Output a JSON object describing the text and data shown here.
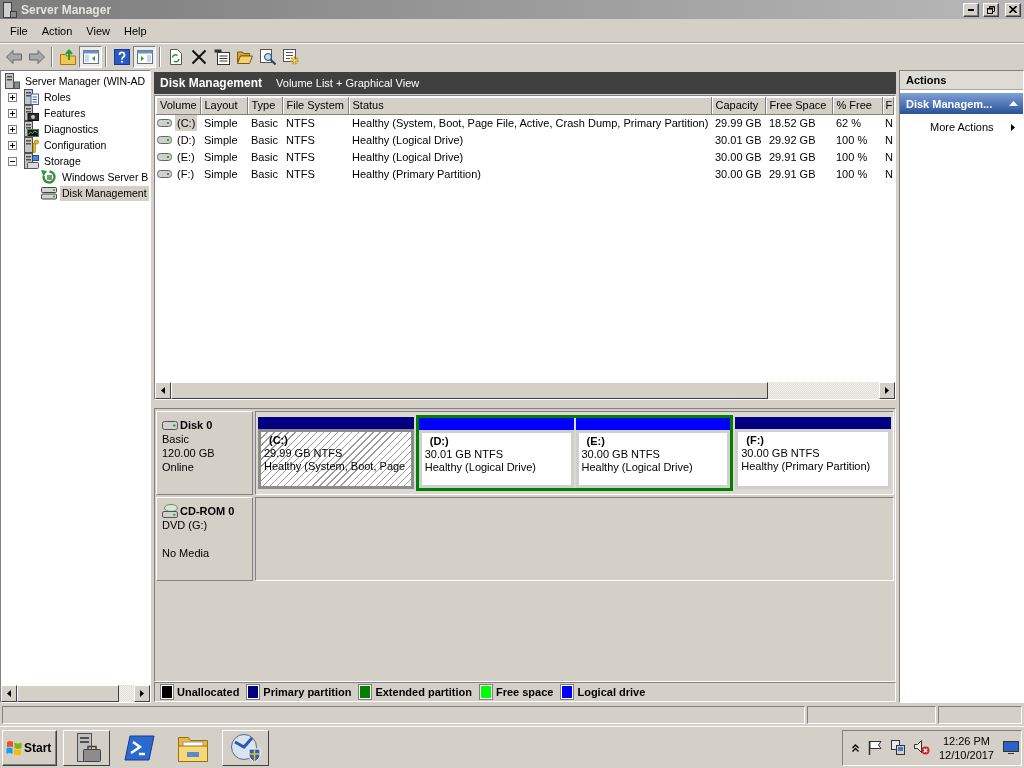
{
  "window": {
    "title": "Server Manager"
  },
  "menu": [
    "File",
    "Action",
    "View",
    "Help"
  ],
  "toolbar": [
    [
      {
        "kind": "back",
        "on": false
      },
      {
        "kind": "forward",
        "on": false
      }
    ],
    [
      {
        "kind": "up",
        "on": false
      },
      {
        "kind": "tree-toggle",
        "on": true
      }
    ],
    [
      {
        "kind": "help",
        "on": false
      },
      {
        "kind": "pane-toggle",
        "on": true
      }
    ],
    [
      {
        "kind": "refresh",
        "on": false
      },
      {
        "kind": "delete",
        "on": false
      },
      {
        "kind": "properties",
        "on": false
      },
      {
        "kind": "open",
        "on": false
      },
      {
        "kind": "find",
        "on": false
      },
      {
        "kind": "settings",
        "on": false
      }
    ]
  ],
  "tree": {
    "kind": "server",
    "label": "Server Manager (WIN-AD",
    "selected": false,
    "children": [
      {
        "kind": "roles",
        "label": "Roles",
        "expanded": false,
        "selected": false
      },
      {
        "kind": "features",
        "label": "Features",
        "expanded": false,
        "selected": false
      },
      {
        "kind": "diagnostics",
        "label": "Diagnostics",
        "expanded": false,
        "selected": false
      },
      {
        "kind": "configuration",
        "label": "Configuration",
        "expanded": false,
        "selected": false
      },
      {
        "kind": "storage",
        "label": "Storage",
        "expanded": true,
        "selected": false,
        "children": [
          {
            "kind": "backup",
            "label": "Windows Server B",
            "selected": false
          },
          {
            "kind": "disk-management",
            "label": "Disk Management",
            "selected": true
          }
        ]
      }
    ]
  },
  "panel": {
    "title": "Disk Management",
    "subtitle": "Volume List + Graphical View"
  },
  "table": {
    "columns": [
      "Volume",
      "Layout",
      "Type",
      "File System",
      "Status",
      "Capacity",
      "Free Space",
      "% Free",
      "F"
    ],
    "rows": [
      {
        "selected": true,
        "cells": [
          "(C:)",
          "Simple",
          "Basic",
          "NTFS",
          "Healthy (System, Boot, Page File, Active, Crash Dump, Primary Partition)",
          "29.99 GB",
          "18.52 GB",
          "62 %",
          "N"
        ]
      },
      {
        "selected": false,
        "cells": [
          "(D:)",
          "Simple",
          "Basic",
          "NTFS",
          "Healthy (Logical Drive)",
          "30.01 GB",
          "29.92 GB",
          "100 %",
          "N"
        ]
      },
      {
        "selected": false,
        "cells": [
          "(E:)",
          "Simple",
          "Basic",
          "NTFS",
          "Healthy (Logical Drive)",
          "30.00 GB",
          "29.91 GB",
          "100 %",
          "N"
        ]
      },
      {
        "selected": false,
        "cells": [
          "(F:)",
          "Simple",
          "Basic",
          "NTFS",
          "Healthy (Primary Partition)",
          "30.00 GB",
          "29.91 GB",
          "100 %",
          "N"
        ]
      }
    ]
  },
  "disks": [
    {
      "kind": "disk",
      "name": "Disk 0",
      "type": "Basic",
      "size": "120.00 GB",
      "status": "Online",
      "partitions": [
        {
          "kind": "primary",
          "color": "#000080",
          "label": "(C:)",
          "size": "29.99 GB NTFS",
          "status": "Healthy (System, Boot, Page",
          "selected": true
        },
        {
          "kind": "extended",
          "color": "#008000",
          "children": [
            {
              "kind": "logical",
              "color": "#0000ff",
              "label": "(D:)",
              "size": "30.01 GB NTFS",
              "status": "Healthy (Logical Drive)",
              "selected": false
            },
            {
              "kind": "logical",
              "color": "#0000ff",
              "label": "(E:)",
              "size": "30.00 GB NTFS",
              "status": "Healthy (Logical Drive)",
              "selected": false
            }
          ]
        },
        {
          "kind": "primary",
          "color": "#000080",
          "label": "(F:)",
          "size": "30.00 GB NTFS",
          "status": "Healthy (Primary Partition)",
          "selected": false
        }
      ]
    },
    {
      "kind": "cdrom",
      "name": "CD-ROM 0",
      "type": "DVD (G:)",
      "status": "No Media"
    }
  ],
  "legend": [
    {
      "label": "Unallocated",
      "color": "#000000"
    },
    {
      "label": "Primary partition",
      "color": "#000080"
    },
    {
      "label": "Extended partition",
      "color": "#008000"
    },
    {
      "label": "Free space",
      "color": "#00ff00"
    },
    {
      "label": "Logical drive",
      "color": "#0000ff"
    }
  ],
  "actions": {
    "title": "Actions",
    "sections": [
      {
        "title": "Disk Managem...",
        "expanded": true,
        "items": [
          {
            "label": "More Actions",
            "submenu": true
          }
        ]
      }
    ]
  },
  "taskbar": {
    "start": "Start",
    "buttons": [
      {
        "kind": "server-manager",
        "open": true
      },
      {
        "kind": "powershell",
        "open": false
      },
      {
        "kind": "explorer",
        "open": false
      },
      {
        "kind": "backup",
        "open": true
      }
    ],
    "tray": {
      "muted": true,
      "time": "12:26 PM",
      "date": "12/10/2017"
    }
  }
}
